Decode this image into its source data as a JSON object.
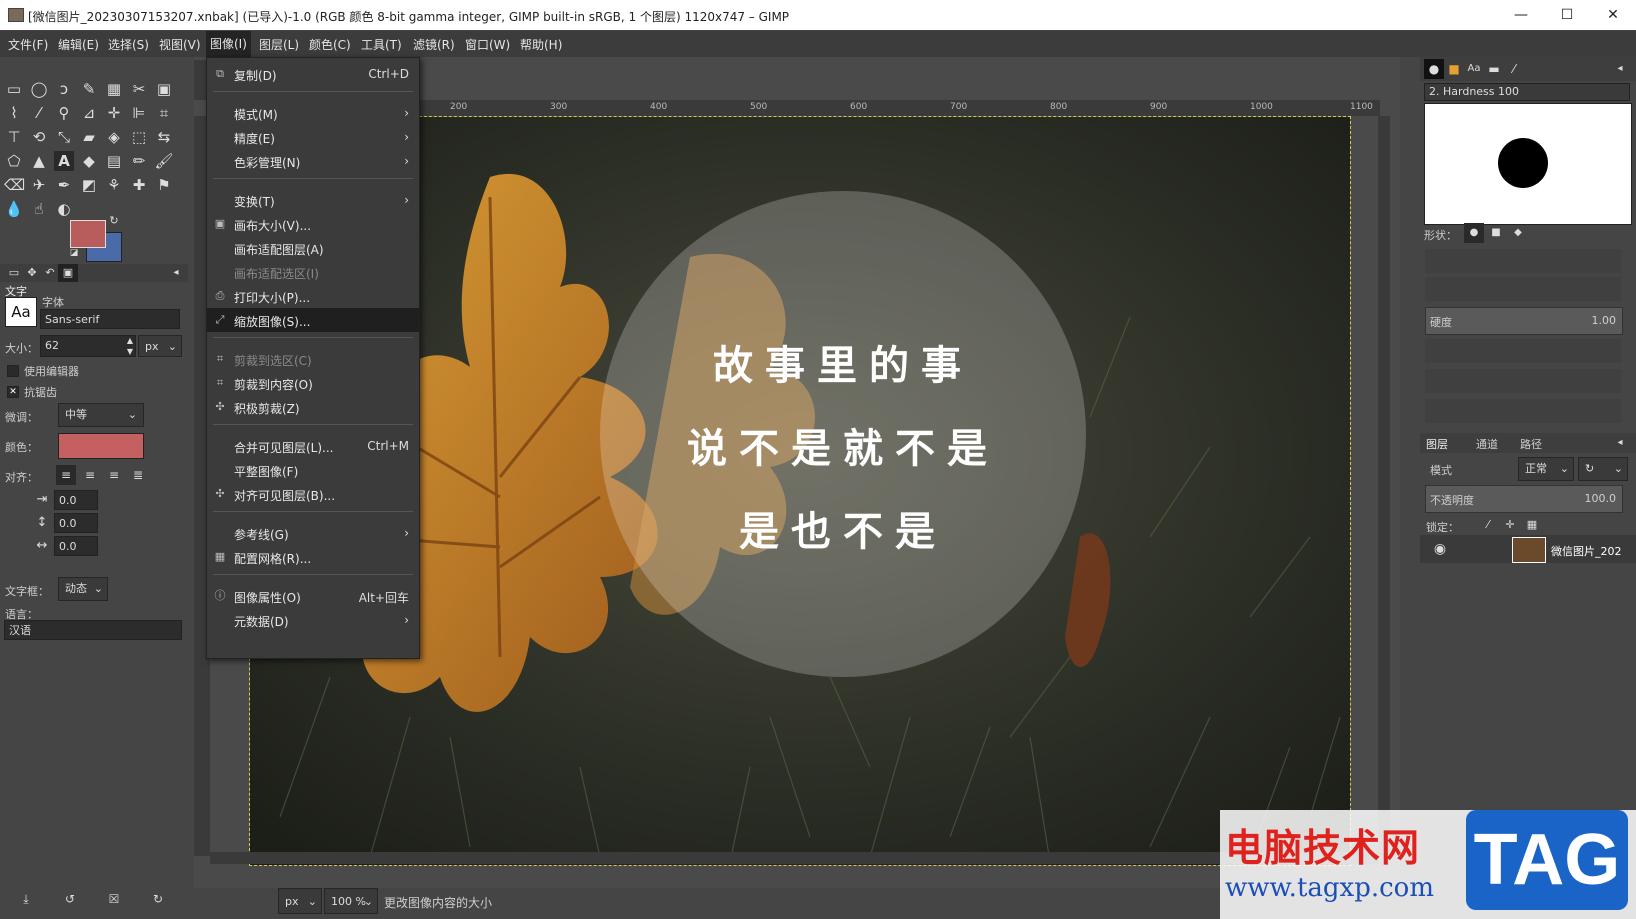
{
  "window": {
    "title": "[微信图片_20230307153207.xnbak] (已导入)-1.0 (RGB 颜色 8-bit gamma integer, GIMP built-in sRGB, 1 个图层) 1120x747 – GIMP",
    "minimize": "—",
    "maximize": "☐",
    "close": "✕"
  },
  "menubar": [
    "文件(F)",
    "编辑(E)",
    "选择(S)",
    "视图(V)",
    "图像(I)",
    "图层(L)",
    "颜色(C)",
    "工具(T)",
    "滤镜(R)",
    "窗口(W)",
    "帮助(H)"
  ],
  "image_menu": {
    "items": [
      {
        "label": "复制(D)",
        "shortcut": "Ctrl+D",
        "icon": "duplicate-icon"
      },
      {
        "label": "模式(M)",
        "submenu": "›"
      },
      {
        "label": "精度(E)",
        "submenu": "›"
      },
      {
        "label": "色彩管理(N)",
        "submenu": "›"
      },
      {
        "label": "变换(T)",
        "submenu": "›"
      },
      {
        "label": "画布大小(V)...",
        "icon": "canvas-size-icon"
      },
      {
        "label": "画布适配图层(A)"
      },
      {
        "label": "画布适配选区(I)",
        "disabled": true
      },
      {
        "label": "打印大小(P)...",
        "icon": "print-icon"
      },
      {
        "label": "缩放图像(S)...",
        "icon": "scale-icon",
        "highlighted": true
      },
      {
        "label": "剪裁到选区(C)",
        "disabled": true,
        "icon": "crop-icon"
      },
      {
        "label": "剪裁到内容(O)",
        "icon": "crop-icon"
      },
      {
        "label": "积极剪裁(Z)",
        "icon": "zealous-icon"
      },
      {
        "label": "合并可见图层(L)...",
        "shortcut": "Ctrl+M"
      },
      {
        "label": "平整图像(F)"
      },
      {
        "label": "对齐可见图层(B)...",
        "icon": "align-icon"
      },
      {
        "label": "参考线(G)",
        "submenu": "›"
      },
      {
        "label": "配置网格(R)...",
        "icon": "grid-icon"
      },
      {
        "label": "图像属性(O)",
        "shortcut": "Alt+回车",
        "icon": "info-icon"
      },
      {
        "label": "元数据(D)",
        "submenu": "›"
      }
    ]
  },
  "toolbox": {
    "text_options": {
      "title": "文字",
      "font_label": "字体",
      "font_icon_text": "Aa",
      "font_value": "Sans-serif",
      "size_label": "大小：",
      "size_value": "62",
      "size_unit": "px",
      "use_editor": "使用编辑器",
      "antialias": "抗锯齿",
      "hinting_label": "微调：",
      "hinting_value": "中等",
      "color_label": "颜色：",
      "justify_label": "对齐：",
      "indent_value": "0.0",
      "line_spacing_value": "0.0",
      "letter_spacing_value": "0.0",
      "box_label": "文字框：",
      "box_value": "动态",
      "language_label": "语言：",
      "language_value": "汉语"
    },
    "colors": {
      "foreground": "#b85c5c",
      "background": "#4a6aa8",
      "text_color": "#c46060"
    }
  },
  "canvas": {
    "ruler_labels": [
      "200",
      "300",
      "400",
      "500",
      "600",
      "700",
      "800",
      "900",
      "1000",
      "1100"
    ],
    "photo_text": [
      "故事里的事",
      "说不是就不是",
      "是也不是"
    ]
  },
  "dock": {
    "brush_name": "2. Hardness 100",
    "shape_label": "形状：",
    "hardness_label": "硬度",
    "hardness_value": "1.00",
    "tabs": [
      "图层",
      "通道",
      "路径"
    ],
    "mode_label": "模式",
    "mode_value": "正常",
    "opacity_label": "不透明度",
    "opacity_value": "100.0",
    "lock_label": "锁定：",
    "layer_name": "微信图片_202"
  },
  "statusbar": {
    "unit": "px",
    "zoom": "100 %",
    "message": "更改图像内容的大小"
  },
  "watermark": {
    "title": "电脑技术网",
    "url": "www.tagxp.com",
    "tag": "TAG"
  }
}
